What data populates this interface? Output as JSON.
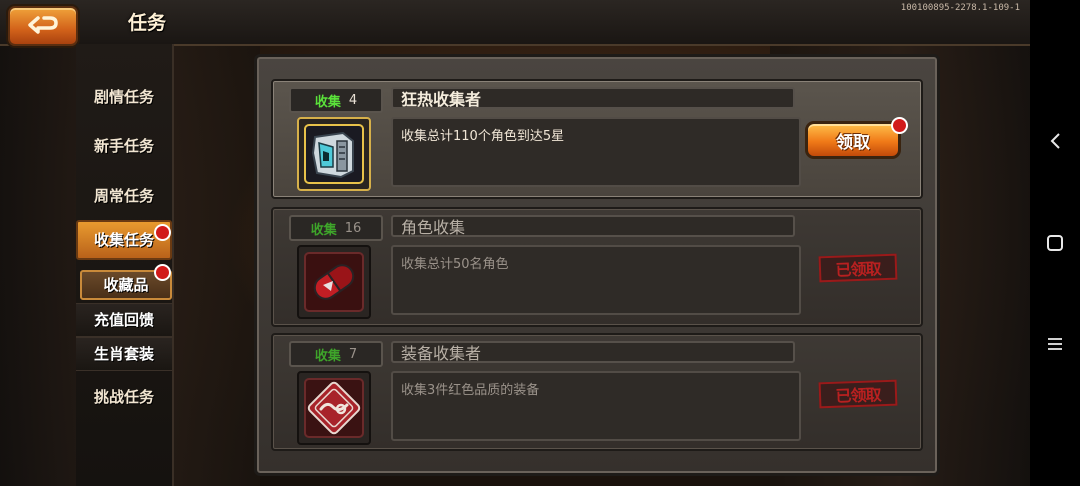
{
  "header": {
    "title": "任务",
    "version": "100100895-2278.1-109-1"
  },
  "nav": {
    "items": [
      {
        "label": "剧情任务"
      },
      {
        "label": "新手任务"
      },
      {
        "label": "周常任务"
      },
      {
        "label": "收集任务"
      },
      {
        "label": "收藏品"
      },
      {
        "label": "充值回馈"
      },
      {
        "label": "生肖套装"
      },
      {
        "label": "挑战任务"
      }
    ]
  },
  "tasks": [
    {
      "tag": "收集",
      "count": "4",
      "name": "狂热收集者",
      "desc": "收集总计110个角色到达5星",
      "action": "领取",
      "icon": "robot-head-icon"
    },
    {
      "tag": "收集",
      "count": "16",
      "name": "角色收集",
      "desc": "收集总计50名角色",
      "status": "已领取",
      "icon": "capsule-icon"
    },
    {
      "tag": "收集",
      "count": "7",
      "name": "装备收集者",
      "desc": "收集3件红色品质的装备",
      "status": "已领取",
      "icon": "gear-badge-icon"
    }
  ],
  "colors": {
    "accent": "#f07a18",
    "notify": "#d11a1a",
    "tag_green": "#5ae13a"
  }
}
